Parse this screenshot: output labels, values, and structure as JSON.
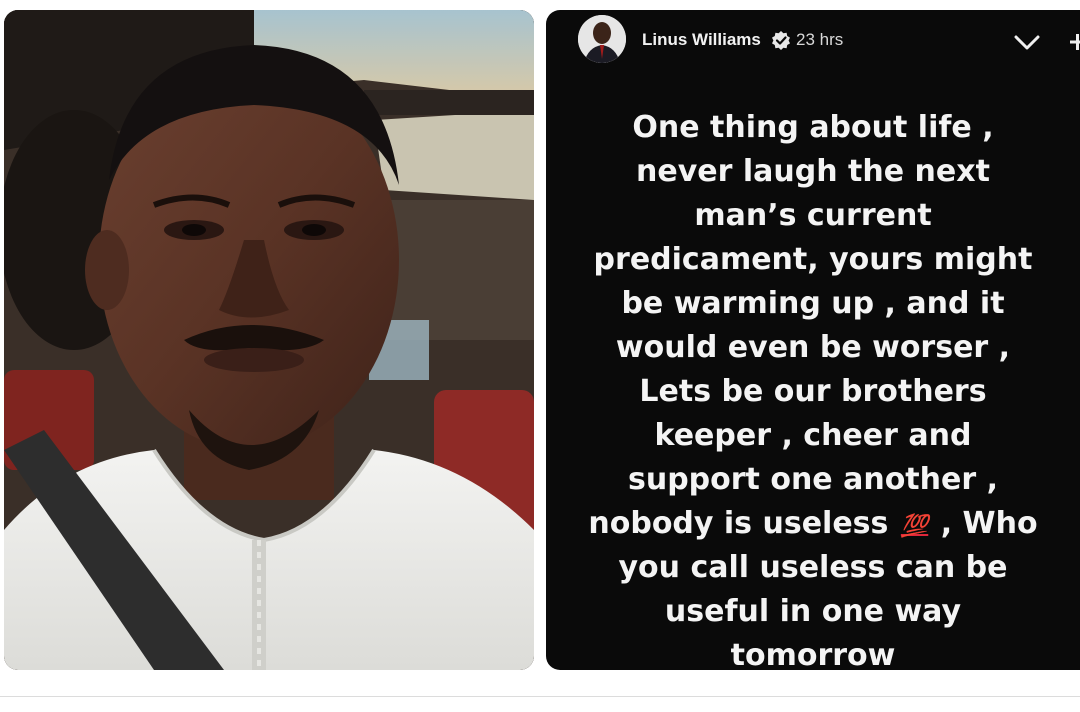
{
  "photo": {
    "description_icon": "selfie-photo"
  },
  "story": {
    "author": {
      "name": "Linus Williams",
      "verified_icon": "verified-badge-icon",
      "time": "23 hrs"
    },
    "controls": {
      "collapse_icon": "chevron-down-icon",
      "more_icon": "more-icon"
    },
    "lines": [
      "One thing about life ,",
      "never laugh the next",
      "man’s current",
      "predicament, yours might",
      "be warming up , and it",
      "would even be worser ,",
      "Lets be our brothers",
      "keeper , cheer and",
      "support one another ,",
      "nobody is useless",
      "you call useless can be",
      "useful in one way",
      "tomorrow"
    ],
    "emoji": "💯",
    "line10_suffix": ", Who",
    "colors": {
      "background": "#0a0a0a",
      "text": "#f4f4f4",
      "emoji": "#e0263a"
    }
  }
}
